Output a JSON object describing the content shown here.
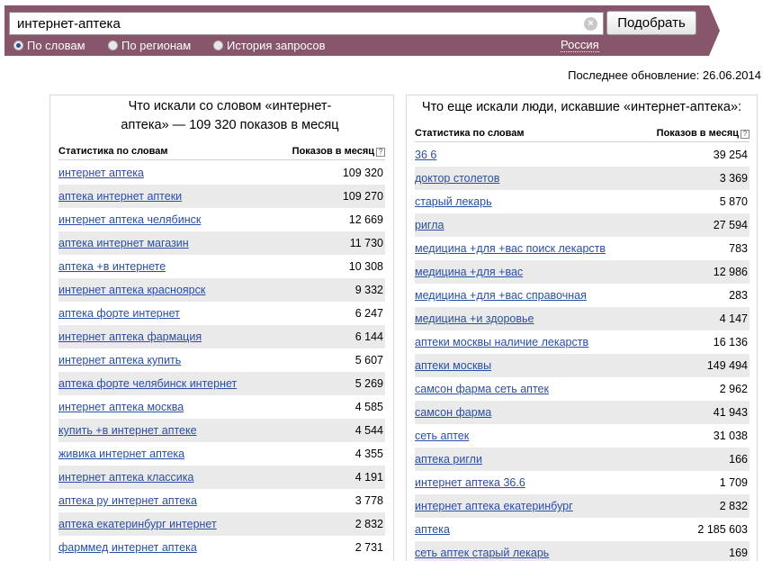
{
  "search": {
    "query": "интернет-аптека",
    "submit_label": "Подобрать",
    "modes": [
      "По словам",
      "По регионам",
      "История запросов"
    ],
    "active_mode_index": 0,
    "region": "Россия"
  },
  "last_updated": "Последнее обновление: 26.06.2014",
  "left_panel": {
    "title_line1": "Что искали со словом «интернет-",
    "title_line2": "аптека» — 109 320 показов в месяц",
    "col_name": "Статистика по словам",
    "col_count": "Показов в месяц",
    "help": "?",
    "rows": [
      {
        "query": "интернет аптека",
        "count": "109 320"
      },
      {
        "query": "аптека интернет аптеки",
        "count": "109 270"
      },
      {
        "query": "интернет аптека челябинск",
        "count": "12 669"
      },
      {
        "query": "аптека интернет магазин",
        "count": "11 730"
      },
      {
        "query": "аптека +в интернете",
        "count": "10 308"
      },
      {
        "query": "интернет аптека красноярск",
        "count": "9 332"
      },
      {
        "query": "аптека форте интернет",
        "count": "6 247"
      },
      {
        "query": "интернет аптека фармация",
        "count": "6 144"
      },
      {
        "query": "интернет аптека купить",
        "count": "5 607"
      },
      {
        "query": "аптека форте челябинск интернет",
        "count": "5 269"
      },
      {
        "query": "интернет аптека москва",
        "count": "4 585"
      },
      {
        "query": "купить +в интернет аптеке",
        "count": "4 544"
      },
      {
        "query": "живика интернет аптека",
        "count": "4 355"
      },
      {
        "query": "интернет аптека классика",
        "count": "4 191"
      },
      {
        "query": "аптека ру интернет аптека",
        "count": "3 778"
      },
      {
        "query": "аптека екатеринбург интернет",
        "count": "2 832"
      },
      {
        "query": "фарммед интернет аптека",
        "count": "2 731"
      }
    ]
  },
  "right_panel": {
    "title": "Что еще искали люди, искавшие «интернет-аптека»:",
    "col_name": "Статистика по словам",
    "col_count": "Показов в месяц",
    "help": "?",
    "rows": [
      {
        "query": "36 6",
        "count": "39 254"
      },
      {
        "query": "доктор столетов",
        "count": "3 369"
      },
      {
        "query": "старый лекарь",
        "count": "5 870"
      },
      {
        "query": "ригла",
        "count": "27 594"
      },
      {
        "query": "медицина +для +вас поиск лекарств",
        "count": "783"
      },
      {
        "query": "медицина +для +вас",
        "count": "12 986"
      },
      {
        "query": "медицина +для +вас справочная",
        "count": "283"
      },
      {
        "query": "медицина +и здоровье",
        "count": "4 147"
      },
      {
        "query": "аптеки москвы наличие лекарств",
        "count": "16 136"
      },
      {
        "query": "аптеки москвы",
        "count": "149 494"
      },
      {
        "query": "самсон фарма сеть аптек",
        "count": "2 962"
      },
      {
        "query": "самсон фарма",
        "count": "41 943"
      },
      {
        "query": "сеть аптек",
        "count": "31 038"
      },
      {
        "query": "аптека ригли",
        "count": "166"
      },
      {
        "query": "интернет аптека 36.6",
        "count": "1 709"
      },
      {
        "query": "интернет аптека екатеринбург",
        "count": "2 832"
      },
      {
        "query": "аптека",
        "count": "2 185 603"
      },
      {
        "query": "сеть аптек старый лекарь",
        "count": "169"
      }
    ]
  },
  "colors": {
    "topbar": "#87566a",
    "link": "#2a4ea3",
    "row_alt": "#eaeaea"
  }
}
